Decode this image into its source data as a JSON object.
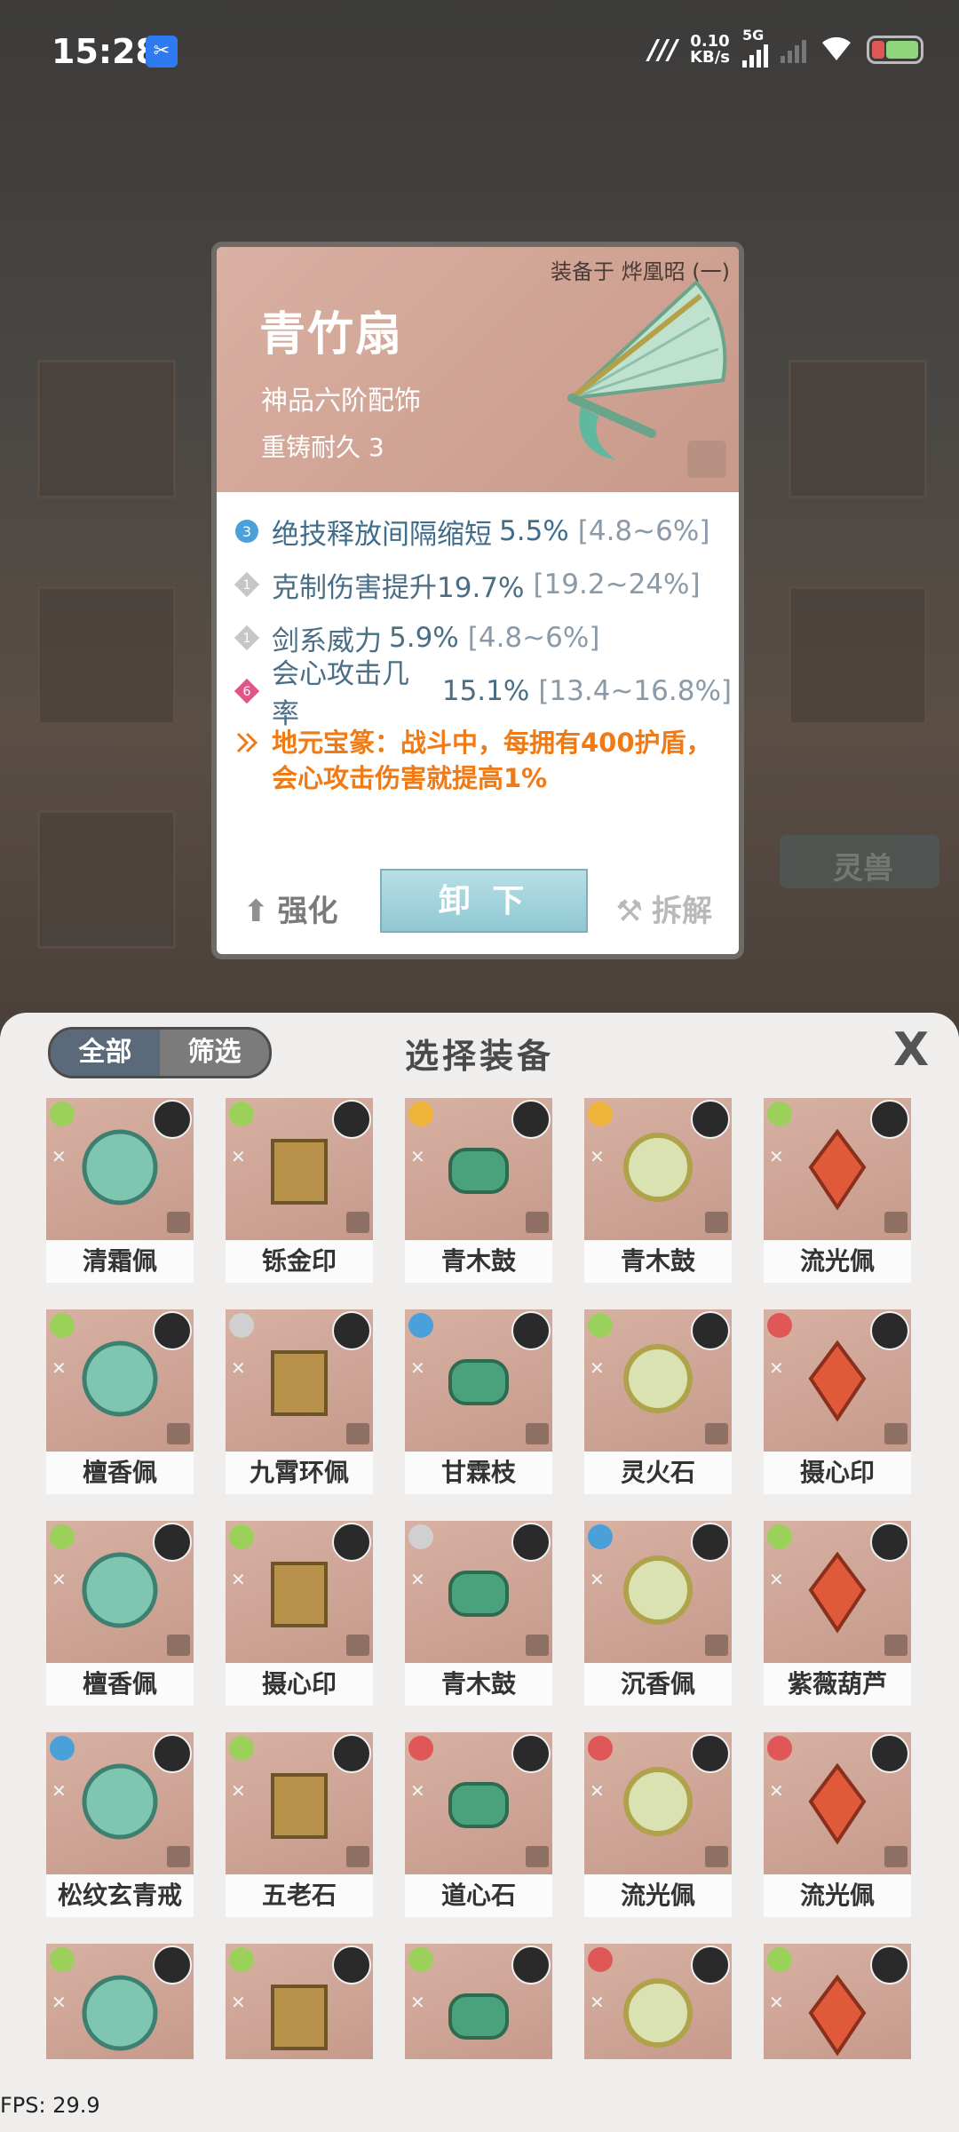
{
  "status": {
    "time": "15:28",
    "net_speed": "0.10",
    "net_unit": "KB/s",
    "net_type": "5G"
  },
  "background": {
    "tab_label": "灵兽"
  },
  "detail": {
    "equipped_text": "装备于 烨凰昭 (一)",
    "name": "青竹扇",
    "grade": "神品六阶配饰",
    "durability": "重铸耐久 3",
    "stats": [
      {
        "gem": "3",
        "text": "绝技释放间隔缩短",
        "value": "5.5%",
        "range": "[4.8~6%]",
        "color": "#4aa0d8"
      },
      {
        "gem": "1",
        "text": "克制伤害提升19.7%",
        "value": "",
        "range": "[19.2~24%]",
        "color": "#b0b0b0"
      },
      {
        "gem": "1",
        "text": "剑系威力",
        "value": "5.9%",
        "range": "[4.8~6%]",
        "color": "#b0b0b0"
      },
      {
        "gem": "6",
        "text": "会心攻击几率",
        "value": "15.1%",
        "range": "[13.4~16.8%]",
        "color": "#e0558a"
      }
    ],
    "special_text": "地元宝篆：战斗中，每拥有400护盾，会心攻击伤害就提高1%",
    "strengthen_label": "强化",
    "unequip_label": "卸 下",
    "dismantle_label": "拆解"
  },
  "panel": {
    "seg_all": "全部",
    "seg_filter": "筛选",
    "title": "选择装备",
    "close": "X"
  },
  "items": [
    {
      "name": "清霜佩",
      "el": "#9bd15a"
    },
    {
      "name": "铄金印",
      "el": "#9bd15a"
    },
    {
      "name": "青木鼓",
      "el": "#f0b43a"
    },
    {
      "name": "青木鼓",
      "el": "#f0b43a"
    },
    {
      "name": "流光佩",
      "el": "#9bd15a"
    },
    {
      "name": "檀香佩",
      "el": "#9bd15a"
    },
    {
      "name": "九霄环佩",
      "el": "#d0d0d0"
    },
    {
      "name": "甘霖枝",
      "el": "#4aa0d8"
    },
    {
      "name": "灵火石",
      "el": "#9bd15a"
    },
    {
      "name": "摄心印",
      "el": "#e05757"
    },
    {
      "name": "檀香佩",
      "el": "#9bd15a"
    },
    {
      "name": "摄心印",
      "el": "#9bd15a"
    },
    {
      "name": "青木鼓",
      "el": "#d0d0d0"
    },
    {
      "name": "沉香佩",
      "el": "#4aa0d8"
    },
    {
      "name": "紫薇葫芦",
      "el": "#9bd15a"
    },
    {
      "name": "松纹玄青戒",
      "el": "#4aa0d8"
    },
    {
      "name": "五老石",
      "el": "#9bd15a"
    },
    {
      "name": "道心石",
      "el": "#e05757"
    },
    {
      "name": "流光佩",
      "el": "#e05757"
    },
    {
      "name": "流光佩",
      "el": "#e05757"
    },
    {
      "name": "",
      "el": "#9bd15a"
    },
    {
      "name": "",
      "el": "#9bd15a"
    },
    {
      "name": "",
      "el": "#9bd15a"
    },
    {
      "name": "",
      "el": "#e05757"
    },
    {
      "name": "",
      "el": "#9bd15a"
    }
  ],
  "fps": "FPS: 29.9"
}
